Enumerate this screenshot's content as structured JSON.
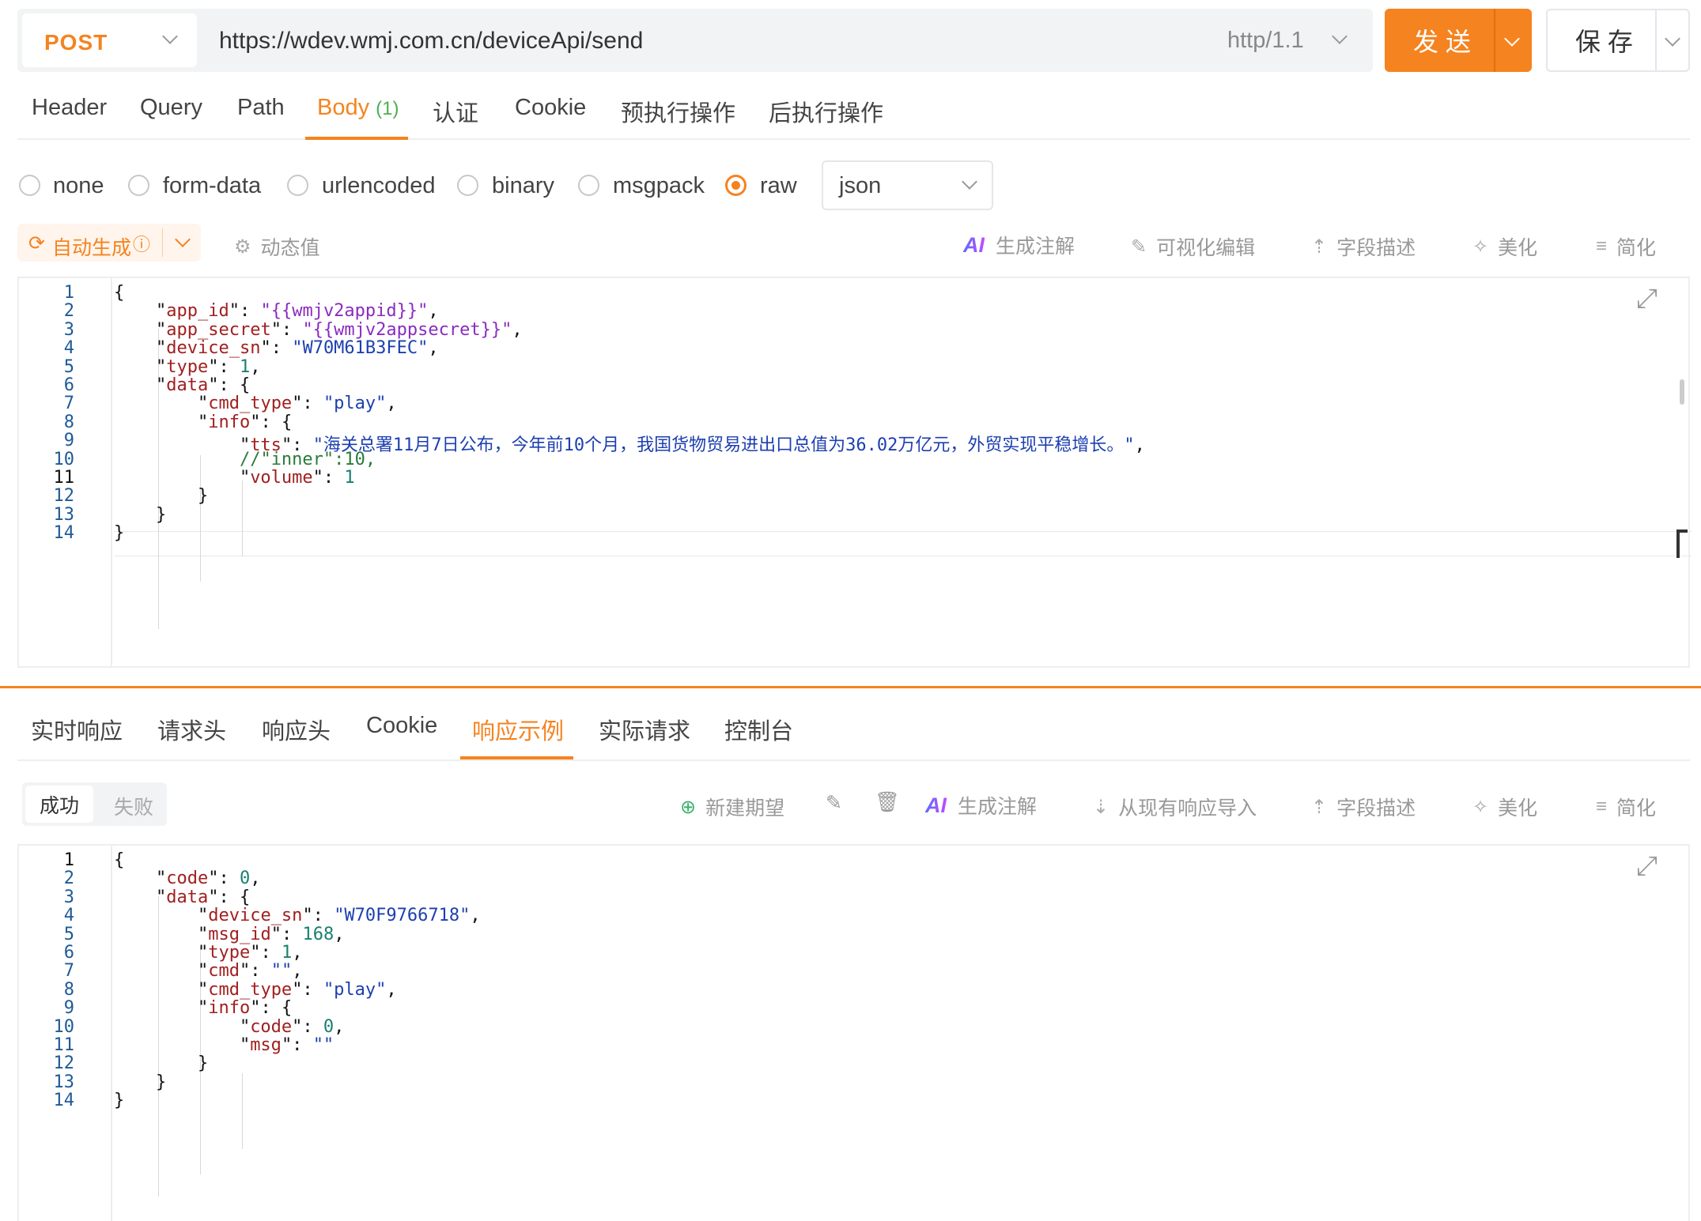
{
  "request": {
    "method": "POST",
    "url": "https://wdev.wmj.com.cn/deviceApi/send",
    "protocol": "http/1.1",
    "send_label": "发 送",
    "save_label": "保 存"
  },
  "request_tabs": [
    {
      "label": "Header"
    },
    {
      "label": "Query"
    },
    {
      "label": "Path"
    },
    {
      "label": "Body",
      "count": "(1)"
    },
    {
      "label": "认证"
    },
    {
      "label": "Cookie"
    },
    {
      "label": "预执行操作"
    },
    {
      "label": "后执行操作"
    }
  ],
  "body_types": [
    "none",
    "form-data",
    "urlencoded",
    "binary",
    "msgpack",
    "raw"
  ],
  "body_type_selected": "raw",
  "format_selected": "json",
  "body_toolbar": {
    "auto_generate": "自动生成",
    "dynamic_value": "动态值",
    "ai_badge": "AI",
    "generate_comments": "生成注解",
    "visual_edit": "可视化编辑",
    "field_description": "字段描述",
    "beautify": "美化",
    "simplify": "简化"
  },
  "request_body_lines": [
    "{",
    "    \"app_id\": \"{{wmjv2appid}}\",",
    "    \"app_secret\": \"{{wmjv2appsecret}}\",",
    "    \"device_sn\": \"W70M61B3FEC\",",
    "    \"type\": 1,",
    "    \"data\": {",
    "        \"cmd_type\": \"play\",",
    "        \"info\": {",
    "            \"tts\": \"海关总署11月7日公布，今年前10个月，我国货物贸易进出口总值为36.02万亿元，外贸实现平稳增长。\",",
    "            //\"inner\":10,",
    "            \"volume\": 1",
    "        }",
    "    }",
    "}"
  ],
  "response_tabs": [
    {
      "label": "实时响应"
    },
    {
      "label": "请求头"
    },
    {
      "label": "响应头"
    },
    {
      "label": "Cookie"
    },
    {
      "label": "响应示例"
    },
    {
      "label": "实际请求"
    },
    {
      "label": "控制台"
    }
  ],
  "response_active_tab": "响应示例",
  "response_segment": {
    "success": "成功",
    "fail": "失败"
  },
  "response_toolbar": {
    "new_expectation": "新建期望",
    "ai_badge": "AI",
    "generate_comments": "生成注解",
    "import_from_response": "从现有响应导入",
    "field_description": "字段描述",
    "beautify": "美化",
    "simplify": "简化"
  },
  "response_body_lines": [
    "{",
    "    \"code\": 0,",
    "    \"data\": {",
    "        \"device_sn\": \"W70F9766718\",",
    "        \"msg_id\": 168,",
    "        \"type\": 1,",
    "        \"cmd\": \"\",",
    "        \"cmd_type\": \"play\",",
    "        \"info\": {",
    "            \"code\": 0,",
    "            \"msg\": \"\"",
    "        }",
    "    }",
    "}"
  ],
  "colors": {
    "accent": "#f5831f",
    "key": "#a11f1f",
    "string": "#1d3fb0",
    "variable": "#8a2bbf",
    "number": "#19806e"
  }
}
